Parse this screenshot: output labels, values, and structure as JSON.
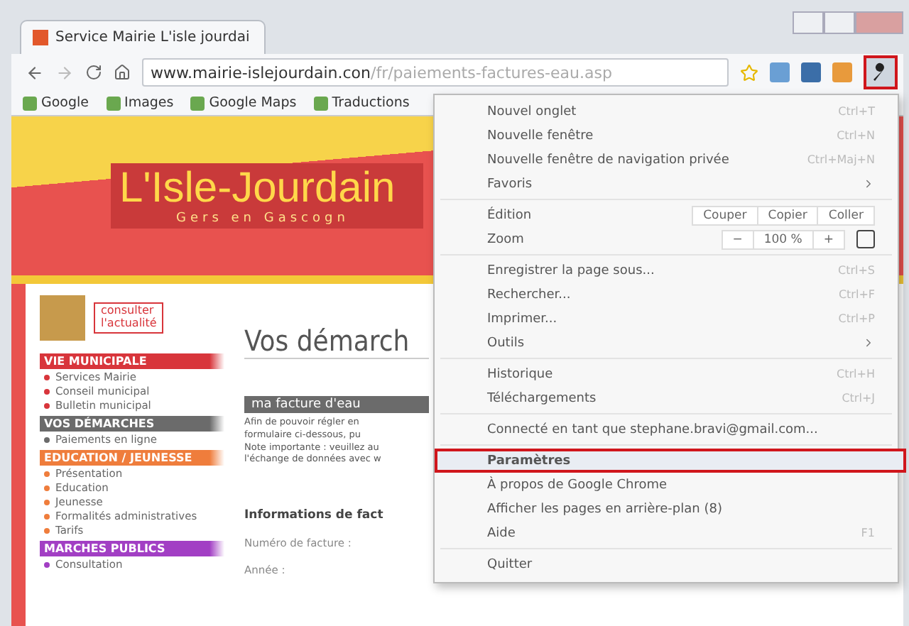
{
  "tab": {
    "title": "Service Mairie L'isle jourdai",
    "selected": true
  },
  "toolbar": {
    "url_host": "www.mairie-islejourdain.con",
    "url_path": "/fr/paiements-factures-eau.asp"
  },
  "bookmarks": [
    "Google",
    "Images",
    "Google Maps",
    "Traductions"
  ],
  "site": {
    "logo": "L'Isle-Jourdain",
    "tagline": "Gers en Gascogn",
    "news_badge": [
      "consulter",
      "l'actualité"
    ],
    "sections": [
      {
        "title": "VIE MUNICIPALE",
        "color": "#d8353b",
        "items": [
          "Services Mairie",
          "Conseil municipal",
          "Bulletin municipal"
        ]
      },
      {
        "title": "VOS DÉMARCHES",
        "color": "#6b6b6b",
        "items": [
          "Paiements en ligne"
        ]
      },
      {
        "title": "EDUCATION / JEUNESSE",
        "color": "#ef7d3c",
        "items": [
          "Présentation",
          "Education",
          "Jeunesse",
          "Formalités administratives",
          "Tarifs"
        ]
      },
      {
        "title": "MARCHES PUBLICS",
        "color": "#a23fc4",
        "items": [
          "Consultation"
        ]
      }
    ],
    "heading": "Vos démarch",
    "banner": "ma facture d'eau",
    "paragraph": [
      "Afin de pouvoir régler en",
      "formulaire ci-dessous, pu",
      "Note importante : veuillez au",
      "l'échange de données avec w"
    ],
    "form_title": "Informations de fact",
    "fields": [
      "Numéro de facture :",
      "Année :"
    ]
  },
  "menu": {
    "groups": [
      [
        {
          "kind": "item",
          "label": "Nouvel onglet",
          "shortcut": "Ctrl+T",
          "selected": false
        },
        {
          "kind": "item",
          "label": "Nouvelle fenêtre",
          "shortcut": "Ctrl+N",
          "selected": false
        },
        {
          "kind": "item",
          "label": "Nouvelle fenêtre de navigation privée",
          "shortcut": "Ctrl+Maj+N",
          "selected": false
        },
        {
          "kind": "submenu",
          "label": "Favoris",
          "selected": false
        }
      ],
      [
        {
          "kind": "edit",
          "label": "Édition",
          "buttons": [
            "Couper",
            "Copier",
            "Coller"
          ]
        },
        {
          "kind": "zoom",
          "label": "Zoom",
          "buttons": [
            "−",
            "100 %",
            "+"
          ]
        }
      ],
      [
        {
          "kind": "item",
          "label": "Enregistrer la page sous...",
          "shortcut": "Ctrl+S",
          "selected": false
        },
        {
          "kind": "item",
          "label": "Rechercher...",
          "shortcut": "Ctrl+F",
          "selected": false
        },
        {
          "kind": "item",
          "label": "Imprimer...",
          "shortcut": "Ctrl+P",
          "selected": false
        },
        {
          "kind": "submenu",
          "label": "Outils",
          "selected": false
        }
      ],
      [
        {
          "kind": "item",
          "label": "Historique",
          "shortcut": "Ctrl+H",
          "selected": false
        },
        {
          "kind": "item",
          "label": "Téléchargements",
          "shortcut": "Ctrl+J",
          "selected": false
        }
      ],
      [
        {
          "kind": "item",
          "label": "Connecté en tant que stephane.bravi@gmail.com...",
          "selected": false
        }
      ],
      [
        {
          "kind": "item",
          "label": "Paramètres",
          "selected": true
        },
        {
          "kind": "item",
          "label": "À propos de Google Chrome",
          "selected": false
        },
        {
          "kind": "item",
          "label": "Afficher les pages en arrière-plan (8)",
          "selected": false
        },
        {
          "kind": "item",
          "label": "Aide",
          "shortcut": "F1",
          "selected": false
        }
      ],
      [
        {
          "kind": "item",
          "label": "Quitter",
          "selected": false
        }
      ]
    ]
  }
}
